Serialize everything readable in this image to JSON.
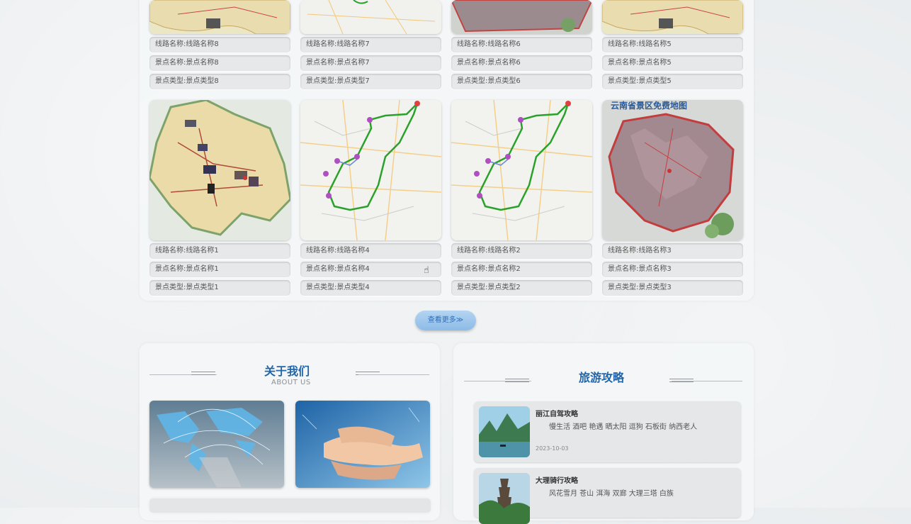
{
  "routes_top": [
    {
      "route": "线路名称:线路名称8",
      "spot": "景点名称:景点名称8",
      "type": "景点类型:景点类型8",
      "map": "yunnan-map"
    },
    {
      "route": "线路名称:线路名称7",
      "spot": "景点名称:景点名称7",
      "type": "景点类型:景点类型7",
      "map": "route-map"
    },
    {
      "route": "线路名称:线路名称6",
      "spot": "景点名称:景点名称6",
      "type": "景点类型:景点类型6",
      "map": "scenic-map"
    },
    {
      "route": "线路名称:线路名称5",
      "spot": "景点名称:景点名称5",
      "type": "景点类型:景点类型5",
      "map": "yunnan-map"
    }
  ],
  "routes_bottom": [
    {
      "route": "线路名称:线路名称1",
      "spot": "景点名称:景点名称1",
      "type": "景点类型:景点类型1",
      "map": "yunnan-map"
    },
    {
      "route": "线路名称:线路名称4",
      "spot": "景点名称:景点名称4",
      "type": "景点类型:景点类型4",
      "map": "route-map"
    },
    {
      "route": "线路名称:线路名称2",
      "spot": "景点名称:景点名称2",
      "type": "景点类型:景点类型2",
      "map": "route-map"
    },
    {
      "route": "线路名称:线路名称3",
      "spot": "景点名称:景点名称3",
      "type": "景点类型:景点类型3",
      "map": "scenic-map"
    }
  ],
  "map_banner": "云南省景区免费地图",
  "more_button": "查看更多≫",
  "about": {
    "title": "关于我们",
    "subtitle": "ABOUT US"
  },
  "guides": {
    "title": "旅游攻略",
    "items": [
      {
        "title": "丽江自驾攻略",
        "desc": "慢生活 酒吧 艳遇 晒太阳 逗狗 石板街 纳西老人",
        "date": "2023-10-03"
      },
      {
        "title": "大理骑行攻略",
        "desc": "风花雪月 苍山 洱海 双廊 大理三塔 白族",
        "date": ""
      }
    ]
  },
  "colors": {
    "accent": "#2266aa",
    "route_line": "#2aa12a",
    "button": "#9cc6ec"
  }
}
